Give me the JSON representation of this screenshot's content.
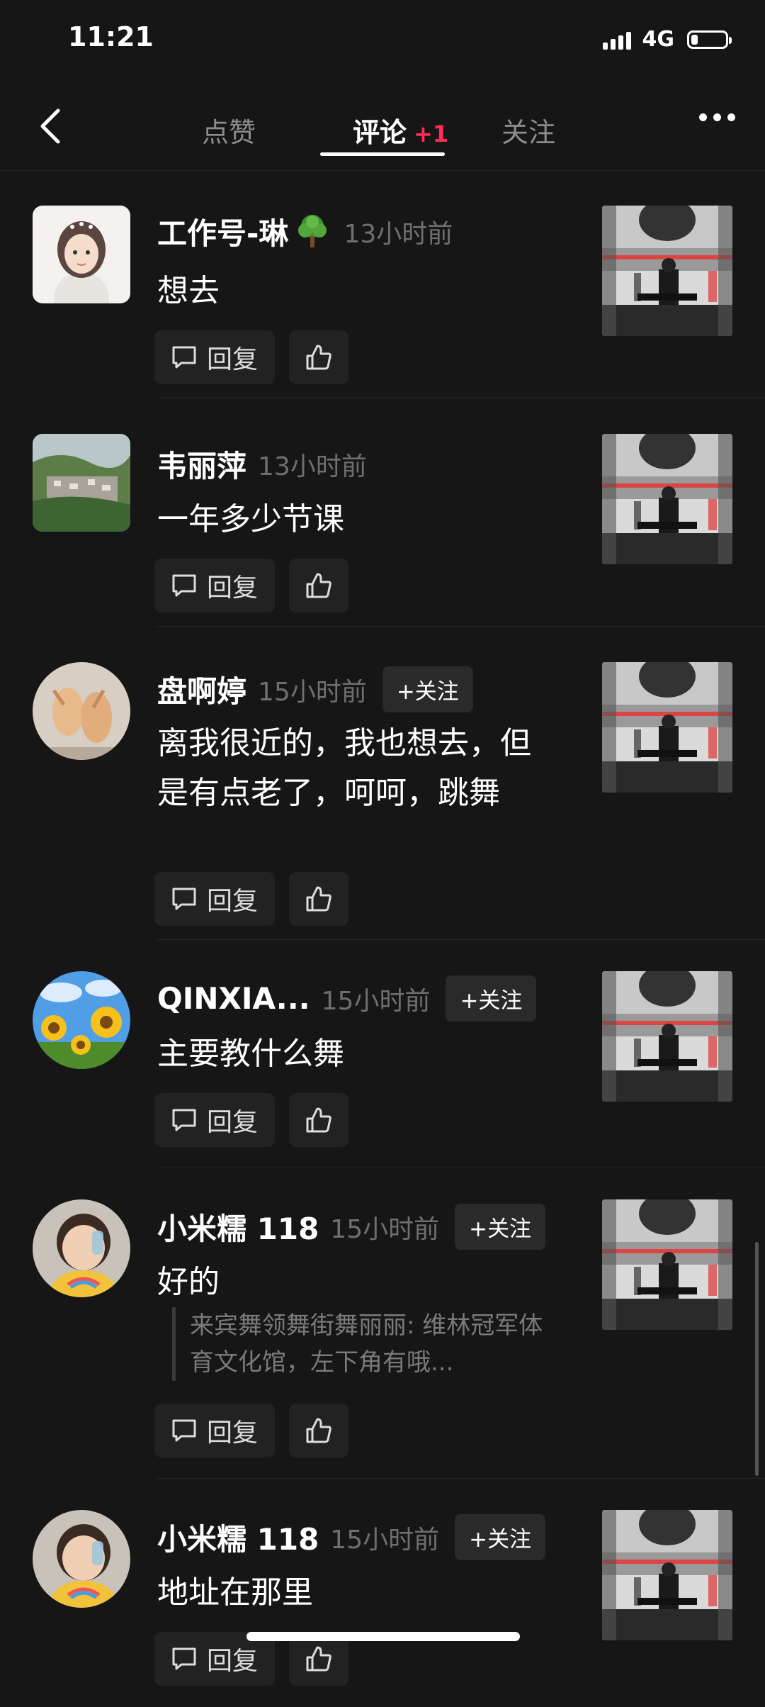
{
  "status": {
    "time": "11:21",
    "network": "4G"
  },
  "nav": {
    "tabs": [
      {
        "label": "点赞"
      },
      {
        "label": "评论",
        "badge": "+1"
      },
      {
        "label": "关注"
      }
    ]
  },
  "actions": {
    "reply_label": "回复",
    "follow_label": "+关注"
  },
  "comments": [
    {
      "name": "工作号-琳",
      "time": "13小时前",
      "text": "想去"
    },
    {
      "name": "韦丽萍",
      "time": "13小时前",
      "text": "一年多少节课"
    },
    {
      "name": "盘啊婷",
      "time": "15小时前",
      "text": "离我很近的，我也想去，但是有点老了，呵呵，跳舞"
    },
    {
      "name": "QINXIA...",
      "time": "15小时前",
      "text": "主要教什么舞"
    },
    {
      "name": "小米糯 118",
      "time": "15小时前",
      "text": "好的",
      "quote": "来宾舞领舞街舞丽丽: 维林冠军体育文化馆，左下角有哦..."
    },
    {
      "name": "小米糯 118",
      "time": "15小时前",
      "text": "地址在那里"
    }
  ],
  "icons": {
    "back": "chevron-left-icon",
    "more": "more-dots-icon",
    "reply": "comment-bubble-icon",
    "like": "thumbs-up-icon",
    "tree_emoji": "tree-emoji-icon"
  },
  "colors": {
    "background": "#161616",
    "badge": "#ff2d55",
    "muted": "#6f6f6f"
  }
}
